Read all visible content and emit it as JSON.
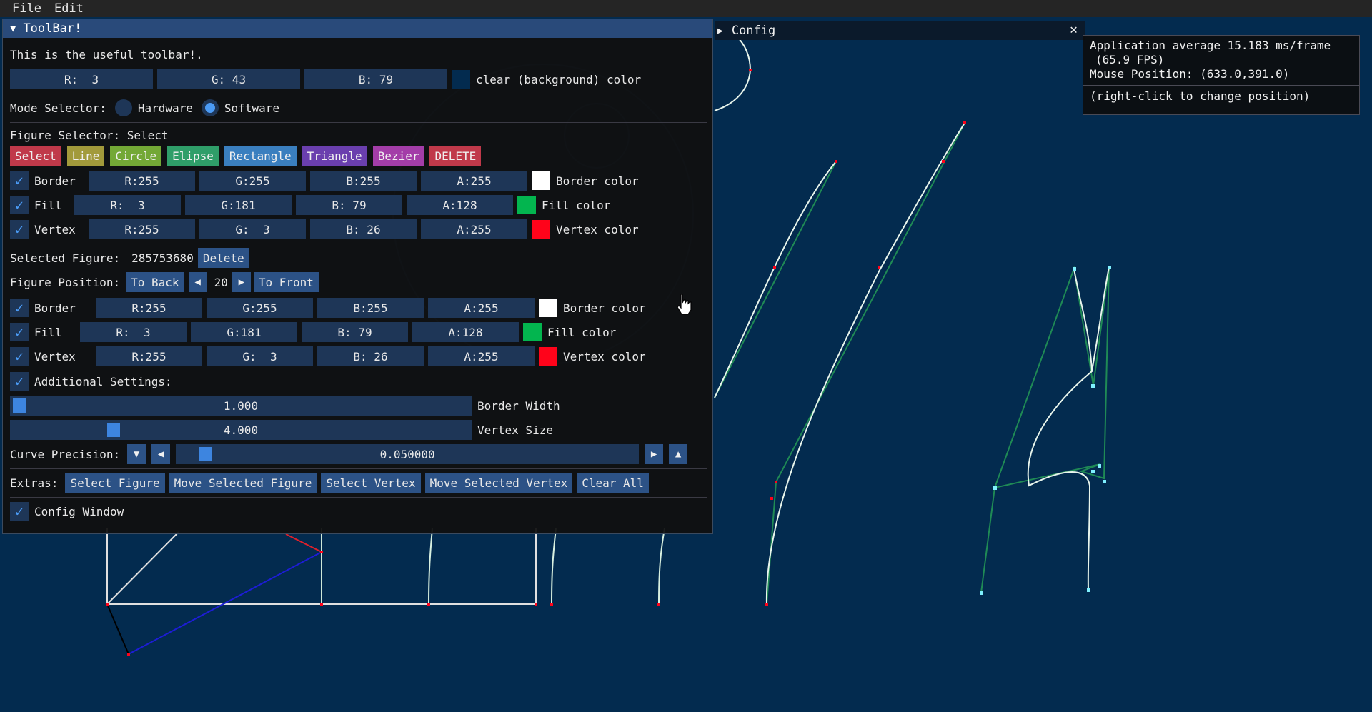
{
  "menubar": {
    "items": [
      "File",
      "Edit"
    ]
  },
  "toolbar": {
    "title": "ToolBar!",
    "subtitle": "This is the useful toolbar!.",
    "clear_color": {
      "r": "R:  3",
      "g": "G: 43",
      "b": "B: 79",
      "label": "clear (background) color",
      "swatch": "#032b4f"
    },
    "mode": {
      "label": "Mode Selector:",
      "options": [
        "Hardware",
        "Software"
      ],
      "selected": "Software"
    },
    "figure_selector": {
      "label": "Figure Selector: Select",
      "buttons": [
        {
          "label": "Select",
          "color": "#c0394a"
        },
        {
          "label": "Line",
          "color": "#a29a3b"
        },
        {
          "label": "Circle",
          "color": "#73a836"
        },
        {
          "label": "Elipse",
          "color": "#2f9e69"
        },
        {
          "label": "Rectangle",
          "color": "#3a7fbf"
        },
        {
          "label": "Triangle",
          "color": "#6a3fae"
        },
        {
          "label": "Bezier",
          "color": "#a33da8"
        },
        {
          "label": "DELETE",
          "color": "#c0394a"
        }
      ]
    },
    "default_colors": [
      {
        "name": "Border",
        "r": "R:255",
        "g": "G:255",
        "b": "B:255",
        "a": "A:255",
        "label": "Border color",
        "swatch": "#ffffff"
      },
      {
        "name": "Fill",
        "r": "R:  3",
        "g": "G:181",
        "b": "B: 79",
        "a": "A:128",
        "label": "Fill color",
        "swatch": "#03b54f"
      },
      {
        "name": "Vertex",
        "r": "R:255",
        "g": "G:  3",
        "b": "B: 26",
        "a": "A:255",
        "label": "Vertex color",
        "swatch": "#ff031a"
      }
    ],
    "selected_figure": {
      "label": "Selected Figure:",
      "id": "285753680",
      "delete": "Delete"
    },
    "position": {
      "label": "Figure Position:",
      "to_back": "To Back",
      "value": "20",
      "to_front": "To Front"
    },
    "figure_colors": [
      {
        "name": "Border",
        "r": "R:255",
        "g": "G:255",
        "b": "B:255",
        "a": "A:255",
        "label": "Border color",
        "swatch": "#ffffff"
      },
      {
        "name": "Fill",
        "r": "R:  3",
        "g": "G:181",
        "b": "B: 79",
        "a": "A:128",
        "label": "Fill color",
        "swatch": "#03b54f"
      },
      {
        "name": "Vertex",
        "r": "R:255",
        "g": "G:  3",
        "b": "B: 26",
        "a": "A:255",
        "label": "Vertex color",
        "swatch": "#ff031a"
      }
    ],
    "additional": {
      "label": "Additional Settings:"
    },
    "border_width": {
      "value": "1.000",
      "label": "Border Width",
      "fraction": 0.0
    },
    "vertex_size": {
      "value": "4.000",
      "label": "Vertex Size",
      "fraction": 0.22
    },
    "curve_precision": {
      "label": "Curve Precision:",
      "value": "0.050000",
      "fraction": 0.05
    },
    "extras": {
      "label": "Extras:",
      "buttons": [
        "Select Figure",
        "Move Selected Figure",
        "Select Vertex",
        "Move Selected Vertex",
        "Clear All"
      ]
    },
    "config_window": {
      "label": "Config Window"
    }
  },
  "config": {
    "title": "Config"
  },
  "overlay": {
    "line1": "Application average 15.183 ms/frame",
    "line2": "(65.9 FPS)",
    "line3": "Mouse Position: (633.0,391.0)",
    "line4": "(right-click to change position)"
  }
}
